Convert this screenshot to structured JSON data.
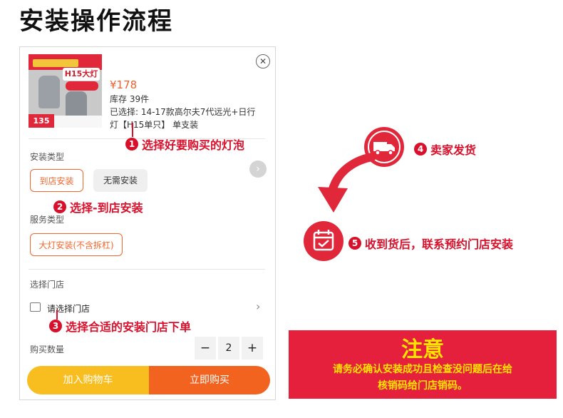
{
  "page_title": "安装操作流程",
  "product": {
    "thumb_h15": "H15大灯",
    "thumb_price": "135",
    "price": "¥178",
    "stock": "库存 39件",
    "selected_line1": "已选择: 14-17款高尔夫7代远光+日行",
    "selected_line2": "灯【H15单只】  单支装"
  },
  "install_type": {
    "label": "安装类型",
    "options": [
      "到店安装",
      "无需安装"
    ],
    "selected": "到店安装"
  },
  "service_type": {
    "label": "服务类型",
    "options": [
      "大灯安装(不含拆杠)"
    ]
  },
  "store": {
    "label": "选择门店",
    "placeholder": "请选择门店"
  },
  "quantity": {
    "label": "购买数量",
    "minus": "−",
    "value": "2",
    "plus": "+"
  },
  "actions": {
    "add_to_cart": "加入购物车",
    "buy_now": "立即购买"
  },
  "steps": [
    {
      "num": "1",
      "text": "选择好要购买的灯泡"
    },
    {
      "num": "2",
      "text": "选择-到店安装"
    },
    {
      "num": "3",
      "text": "选择合适的安装门店下单"
    },
    {
      "num": "4",
      "text": "卖家发货"
    },
    {
      "num": "5",
      "text": "收到货后，联系预约门店安装"
    }
  ],
  "notice": {
    "title": "注意",
    "text": "请务必确认安装成功且检查没问题后在给\n核销码给门店销码。"
  },
  "colors": {
    "accent_orange": "#f2631f",
    "accent_yellow": "#f8bd1e",
    "annotation_red": "#d8102b",
    "notice_bg": "#e5203d",
    "notice_text": "#ffe400"
  },
  "icons": {
    "close": "close-icon",
    "side_arrow": "chevron-right-icon",
    "store": "store-icon",
    "store_chevron": "chevron-right-icon",
    "truck": "truck-icon",
    "calendar": "calendar-check-icon",
    "curve_arrow": "curved-arrow-icon"
  }
}
